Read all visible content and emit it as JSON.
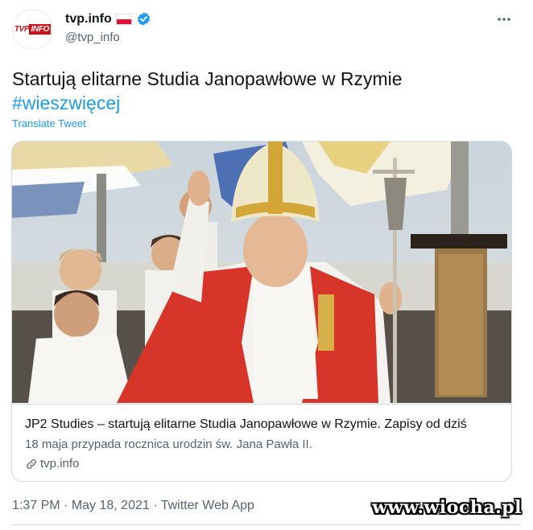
{
  "account": {
    "avatar_logo_left": "TVP",
    "avatar_logo_right": "INFO",
    "name": "tvp.info",
    "handle": "@tvp_info",
    "flag_colors": [
      "#ffffff",
      "#dc143c"
    ],
    "verified_color": "#1d9bf0"
  },
  "tweet": {
    "text": "Startują elitarne Studia Janopawłowe w Rzymie",
    "hashtag": "#wieszwięcej",
    "translate_label": "Translate Tweet"
  },
  "card": {
    "title": "JP2 Studies – startują elitarne Studia Janopawłowe w Rzymie. Zapisy od dziś",
    "description": "18 maja przypada rocznica urodzin św. Jana Pawła II.",
    "domain": "tvp.info"
  },
  "meta": {
    "time": "1:37 PM",
    "separator1": " · ",
    "date": "May 18, 2021",
    "separator2": " · ",
    "source": "Twitter Web App"
  },
  "watermark": "www.wiocha.pl",
  "colors": {
    "accent": "#1d9bf0",
    "secondary_text": "#536471",
    "border": "#cfd9de"
  }
}
